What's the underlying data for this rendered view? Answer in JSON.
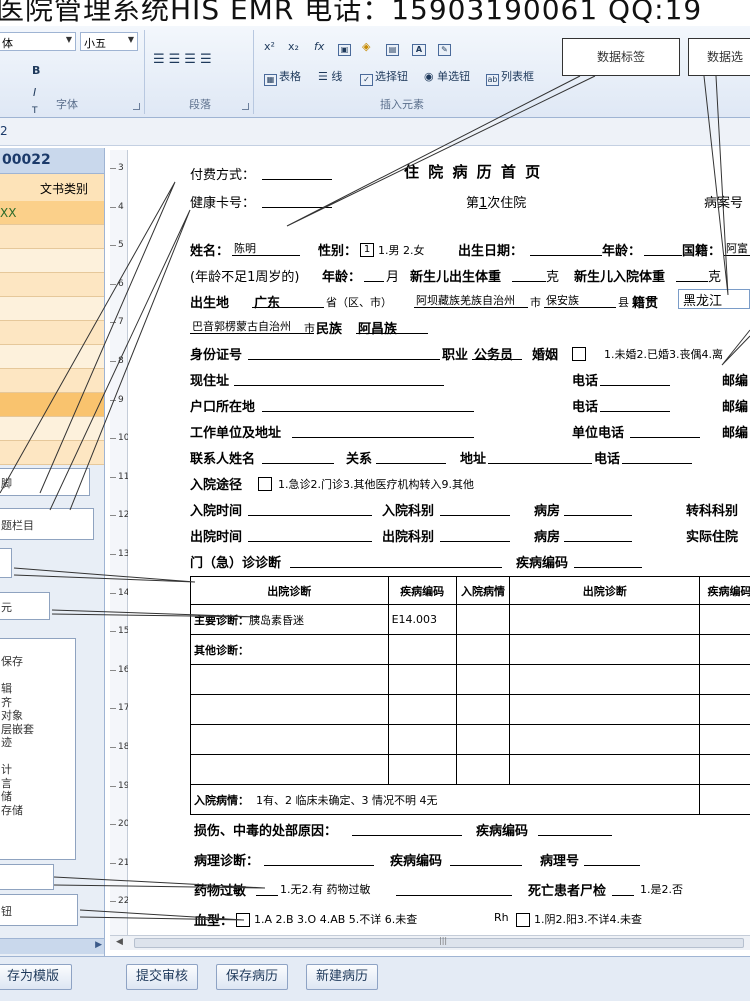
{
  "titlebar": {
    "text": "医院管理系统HIS EMR  电话：15903190061 QQ:19"
  },
  "ribbon": {
    "font_name": "体",
    "font_size": "小五",
    "font_group": "字体",
    "para_group": "段落",
    "insert_group": "插入元素",
    "table_btn": "表格",
    "line_btn": "线",
    "checkbox_btn": "选择钮",
    "radio_btn": "单选钮",
    "listbox_btn": "列表框"
  },
  "callouts": {
    "data_label": "数据标签",
    "data_select": "数据选"
  },
  "tabstrip": {
    "tab": "2"
  },
  "leftpanel": {
    "patient_id": "00022",
    "col_doc_type": "文书类别",
    "first_row": "XX",
    "box1": "脚",
    "box2": "题栏目",
    "box3": "元",
    "list": [
      "保存",
      "",
      "辑",
      "齐",
      "对象",
      "层嵌套",
      "迹",
      "",
      "计",
      "言",
      "储",
      "存储"
    ],
    "box4": "钮"
  },
  "ruler": {
    "ticks": [
      "3",
      "4",
      "5",
      "6",
      "7",
      "8",
      "9",
      "10",
      "11",
      "12",
      "13",
      "14",
      "15",
      "16",
      "17",
      "18",
      "19",
      "20",
      "21",
      "22"
    ]
  },
  "doc": {
    "pay_method": "付费方式：",
    "health_card": "健康卡号：",
    "title": "住 院 病 历 首 页",
    "admission_seq_prefix": "第",
    "admission_seq": "1",
    "admission_seq_suffix": "次住院",
    "case_no": "病案号",
    "name_label": "姓名：",
    "name": "陈明",
    "gender_label": "性别：",
    "gender_value": "1",
    "gender_opts": "1.男  2.女",
    "birth_label": "出生日期：",
    "age_label": "年龄：",
    "nationality_label": "国籍：",
    "nationality": "阿富",
    "infant_note": "(年龄不足1周岁的)",
    "age2_label": "年龄：",
    "month": "月",
    "nb_weight_label": "新生儿出生体重",
    "gram": "克",
    "nb_admit_weight_label": "新生儿入院体重",
    "gram2": "克",
    "birthplace_label": "出生地",
    "birth_province": "广东",
    "province": "省（区、市）",
    "birth_city": "阿坝藏族羌族自治州",
    "city": "市",
    "birth_county": "保安族",
    "county": "县",
    "native_label": "籍贯",
    "native_place": "黑龙江",
    "native_city": "巴音郭楞蒙古自治州",
    "native_city_suffix": "市",
    "ethnic_label": "民族",
    "ethnic": "阿昌族",
    "id_label": "身份证号",
    "job_label": "职业",
    "job": "公务员",
    "marriage_label": "婚姻",
    "marriage_opts": "1.未婚2.已婚3.丧偶4.离",
    "address_label": "现住址",
    "phone_label": "电话",
    "zip_label": "邮编",
    "hukou_label": "户口所在地",
    "phone2_label": "电话",
    "zip2_label": "邮编",
    "work_label": "工作单位及地址",
    "work_phone_label": "单位电话",
    "zip3_label": "邮编",
    "contact_label": "联系人姓名",
    "relation_label": "关系",
    "addr2_label": "地址",
    "phone3_label": "电话",
    "admit_route_label": "入院途径",
    "admit_route_opts": "1.急诊2.门诊3.其他医疗机构转入9.其他",
    "admit_time_label": "入院时间",
    "admit_dept_label": "入院科别",
    "ward_label": "病房",
    "transfer_label": "转科科别",
    "discharge_time_label": "出院时间",
    "discharge_dept_label": "出院科别",
    "ward2_label": "病房",
    "actual_stay_label": "实际住院",
    "outpatient_label": "门（急）诊诊断",
    "disease_code_label": "疾病编码",
    "table": {
      "h1": "出院诊断",
      "h2": "疾病编码",
      "h3": "入院病情",
      "h4": "出院诊断",
      "h5": "疾病编码",
      "main_dx_label": "主要诊断：",
      "main_dx": "胰岛素昏迷",
      "main_dx_code": "E14.003",
      "other_dx_label": "其他诊断："
    },
    "admit_cond_label": "入院病情：",
    "admit_cond_opts": "1有、2  临床未确定、3  情况不明  4无",
    "injury_label": "损伤、中毒的处部原因：",
    "injury_code_label": "疾病编码",
    "path_label": "病理诊断：",
    "path_code_label": "疾病编码",
    "path_no_label": "病理号",
    "allergy_label": "药物过敏",
    "allergy_opts": "1.无2.有  药物过敏",
    "autopsy_label": "死亡患者尸检",
    "autopsy_opts": "1.是2.否",
    "blood_label": "血型：",
    "blood_opts": "1.A  2.B  3.O  4.AB  5.不详  6.未查",
    "rh_label": "Rh",
    "rh_opts": "1.阴2.阳3.不详4.未查"
  },
  "bottom": {
    "save_template": "存为模版",
    "submit": "提交审核",
    "save_record": "保存病历",
    "new_record": "新建病历"
  }
}
